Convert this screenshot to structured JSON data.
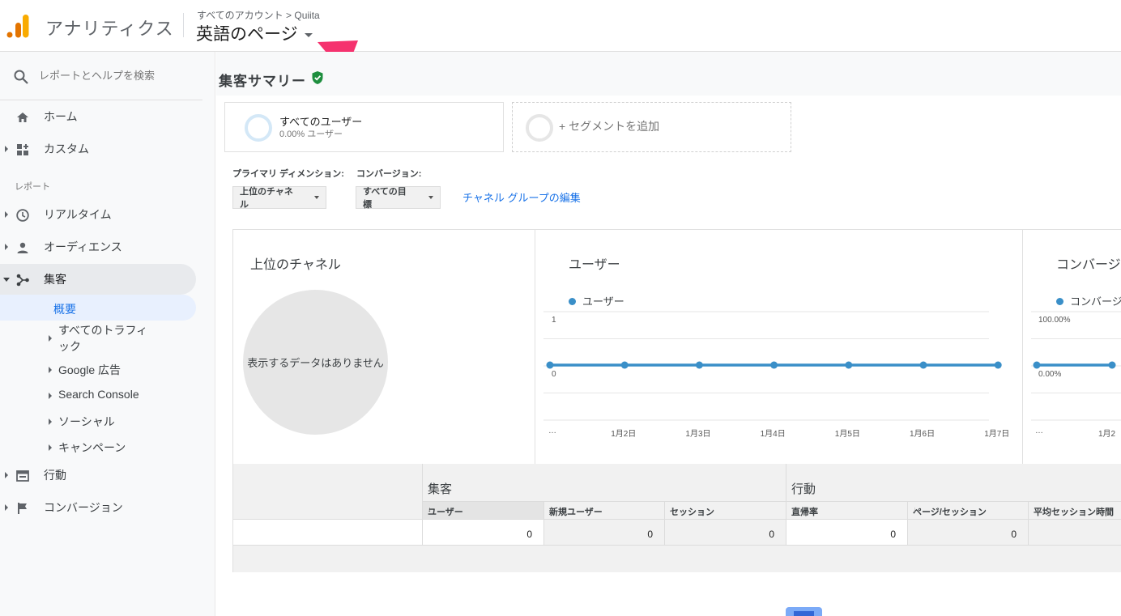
{
  "header": {
    "app_title": "アナリティクス",
    "breadcrumb": "すべてのアカウント > Quiita",
    "property": "英語のページ"
  },
  "sidebar": {
    "search_placeholder": "レポートとヘルプを検索",
    "home": "ホーム",
    "custom": "カスタム",
    "section_label": "レポート",
    "realtime": "リアルタイム",
    "audience": "オーディエンス",
    "acquisition": "集客",
    "acquisition_sub": {
      "overview": "概要",
      "all_traffic_1": "すべてのトラフィ",
      "all_traffic_2": "ック",
      "google_ads": "Google 広告",
      "search_console": "Search Console",
      "social": "ソーシャル",
      "campaigns": "キャンペーン"
    },
    "behavior": "行動",
    "conversions": "コンバージョン"
  },
  "report": {
    "title": "集客サマリー",
    "segment": {
      "name": "すべてのユーザー",
      "sub": "0.00% ユーザー"
    },
    "add_segment": "+ セグメントを追加",
    "primary_dimension_label": "プライマリ ディメンション:",
    "primary_dimension_value": "上位のチャネル",
    "conversion_label": "コンバージョン:",
    "conversion_value": "すべての目標",
    "edit_link": "チャネル グループの編集"
  },
  "charts": {
    "top_channels": {
      "title": "上位のチャネル",
      "empty": "表示するデータはありません"
    },
    "users": {
      "title": "ユーザー",
      "legend": "ユーザー",
      "y_top": "1",
      "y_bottom": "0"
    },
    "conversion": {
      "title": "コンバージ",
      "legend": "コンバージ",
      "y_top": "100.00%",
      "y_bottom": "0.00%"
    },
    "x_labels": [
      "…",
      "1月2日",
      "1月3日",
      "1月4日",
      "1月5日",
      "1月6日",
      "1月7日"
    ],
    "conv_x_labels": [
      "…",
      "1月2"
    ]
  },
  "chart_data": [
    {
      "type": "line",
      "title": "ユーザー",
      "categories": [
        "…",
        "1月2日",
        "1月3日",
        "1月4日",
        "1月5日",
        "1月6日",
        "1月7日"
      ],
      "series": [
        {
          "name": "ユーザー",
          "values": [
            0,
            0,
            0,
            0,
            0,
            0,
            0
          ]
        }
      ],
      "ylim": [
        0,
        1
      ],
      "color": "#3a8fc8"
    },
    {
      "type": "line",
      "title": "コンバージ",
      "categories": [
        "…",
        "1月2"
      ],
      "series": [
        {
          "name": "コンバージ",
          "values": [
            0,
            0
          ]
        }
      ],
      "ylim": [
        0,
        100
      ],
      "color": "#3a8fc8"
    }
  ],
  "table": {
    "group_acquisition": "集客",
    "group_behavior": "行動",
    "headers": [
      "ユーザー",
      "新規ユーザー",
      "セッション",
      "直帰率",
      "ページ/セッション",
      "平均セッション時間"
    ],
    "sort_desc": "↓",
    "sort_neutral": "↓",
    "values": [
      "0",
      "0",
      "0",
      "0",
      "0"
    ]
  }
}
